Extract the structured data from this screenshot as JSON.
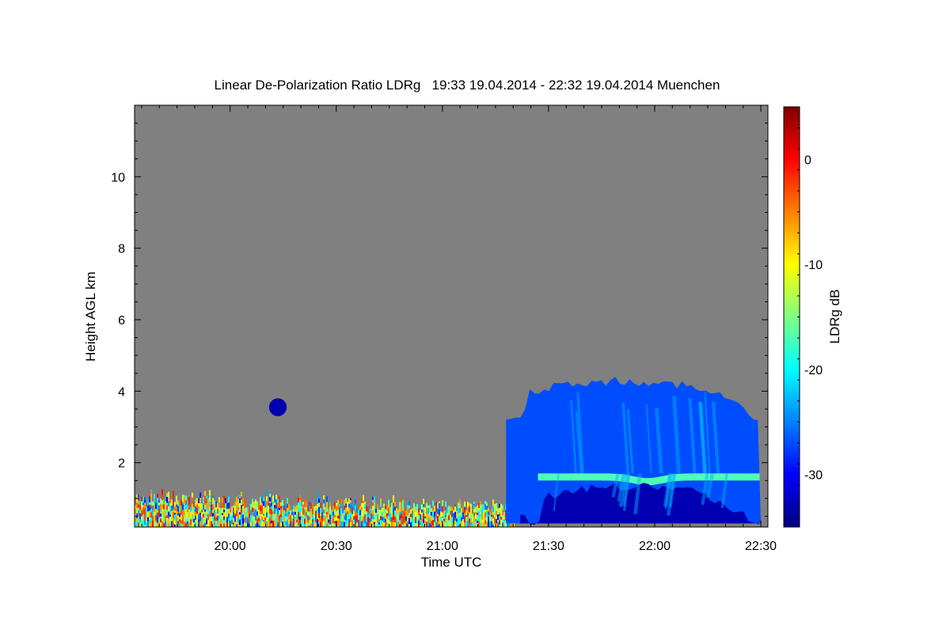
{
  "chart_data": {
    "type": "heatmap",
    "title": "Linear De-Polarization Ratio LDRg   19:33 19.04.2014 - 22:32 19.04.2014 Muenchen",
    "xlabel": "Time UTC",
    "ylabel": "Height AGL km",
    "x_ticks": [
      {
        "label": "20:00",
        "value": 1200
      },
      {
        "label": "20:30",
        "value": 1230
      },
      {
        "label": "21:00",
        "value": 1260
      },
      {
        "label": "21:30",
        "value": 1290
      },
      {
        "label": "22:00",
        "value": 1320
      },
      {
        "label": "22:30",
        "value": 1350
      }
    ],
    "y_ticks": [
      2,
      4,
      6,
      8,
      10
    ],
    "xlim_minutes": [
      1173,
      1352
    ],
    "ylim_km": [
      0.2,
      12
    ],
    "colorbar": {
      "label": "LDRg dB",
      "ticks": [
        0,
        -10,
        -20,
        -30
      ],
      "range": [
        -35,
        5
      ],
      "colormap": [
        "#00007f",
        "#0000ff",
        "#0080ff",
        "#00ffff",
        "#80ff80",
        "#ffff00",
        "#ff8000",
        "#ff0000",
        "#7f0000"
      ]
    },
    "background_color": "#808080",
    "features": [
      {
        "name": "boundary layer (mixed noisy LDR)",
        "t_start": 1173,
        "t_end": 1280,
        "h_bottom": 0.2,
        "h_top": 1.2,
        "ldr_db_range": [
          -30,
          0
        ]
      },
      {
        "name": "isolated echo",
        "t_start": 1211,
        "t_end": 1216,
        "h_bottom": 3.3,
        "h_top": 3.8,
        "ldr_db": -33
      },
      {
        "name": "ice cloud / precipitation",
        "t_start": 1278,
        "t_end": 1350,
        "h_bottom": 0.3,
        "h_top": 4.4,
        "ldr_db": -27
      },
      {
        "name": "melting layer bright band",
        "t_start": 1287,
        "t_end": 1350,
        "h_bottom": 1.5,
        "h_top": 1.7,
        "ldr_db": -17
      },
      {
        "name": "rain below melting layer",
        "t_start": 1282,
        "t_end": 1350,
        "h_bottom": 0.3,
        "h_top": 1.45,
        "ldr_db": -33
      }
    ]
  }
}
